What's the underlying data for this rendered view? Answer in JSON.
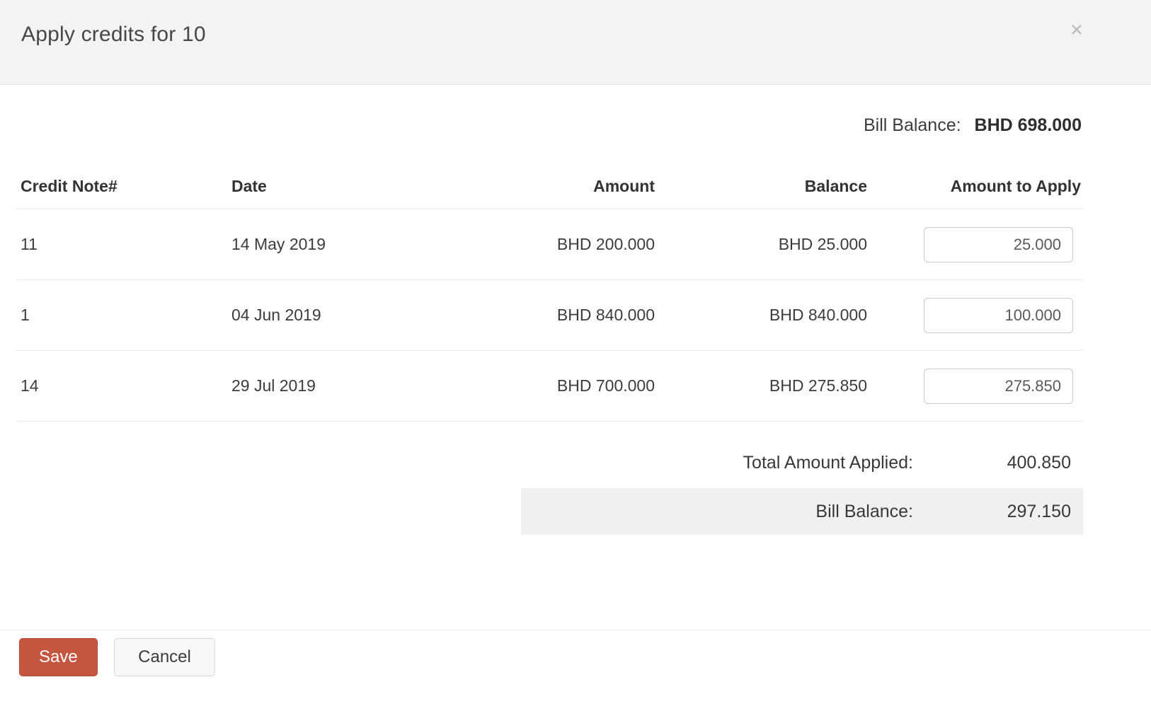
{
  "modal": {
    "title": "Apply credits for 10",
    "close_icon": "×"
  },
  "bill_summary": {
    "label": "Bill Balance:",
    "value": "BHD 698.000"
  },
  "table": {
    "columns": {
      "credit_note": "Credit Note#",
      "date": "Date",
      "amount": "Amount",
      "balance": "Balance",
      "amount_to_apply": "Amount to Apply"
    },
    "rows": [
      {
        "credit_note": "11",
        "date": "14 May 2019",
        "amount": "BHD 200.000",
        "balance": "BHD 25.000",
        "amount_to_apply": "25.000"
      },
      {
        "credit_note": "1",
        "date": "04 Jun 2019",
        "amount": "BHD 840.000",
        "balance": "BHD 840.000",
        "amount_to_apply": "100.000"
      },
      {
        "credit_note": "14",
        "date": "29 Jul 2019",
        "amount": "BHD 700.000",
        "balance": "BHD 275.850",
        "amount_to_apply": "275.850"
      }
    ]
  },
  "totals": {
    "applied_label": "Total Amount Applied:",
    "applied_value": "400.850",
    "balance_label": "Bill Balance:",
    "balance_value": "297.150"
  },
  "footer": {
    "save_label": "Save",
    "cancel_label": "Cancel"
  },
  "colors": {
    "save_button_bg": "#c65540",
    "header_bg": "#f3f3f3",
    "totals_panel_bg": "#f0f0f0",
    "row_divider": "#ebebeb",
    "input_border": "#c9c9c9"
  }
}
